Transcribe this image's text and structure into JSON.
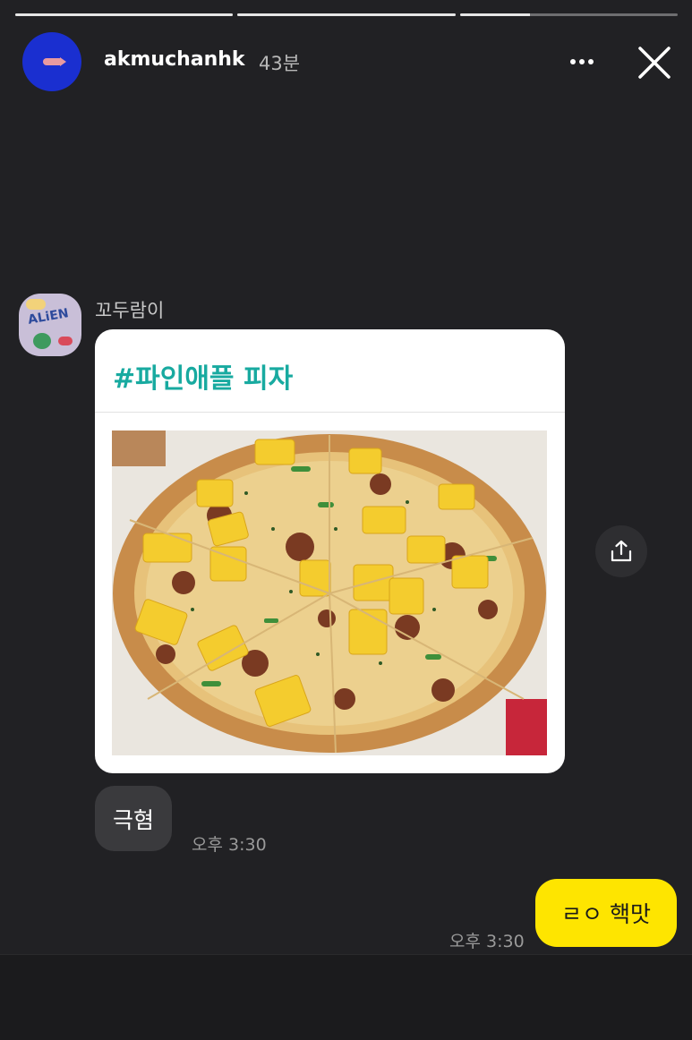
{
  "story": {
    "progress": [
      1.0,
      1.0,
      0.32
    ],
    "username": "akmuchanhk",
    "time": "43분",
    "avatar_color": "#1a2fd0"
  },
  "icons": {
    "more": "more-horizontal-icon",
    "close": "close-icon",
    "share": "share-icon"
  },
  "chat": {
    "sender_name": "꼬두람이",
    "card": {
      "title": "#파인애플 피자",
      "title_color": "#18aaa0"
    },
    "incoming": {
      "text": "극혐",
      "time": "오후 3:30"
    },
    "outgoing": {
      "text": "ㄹㅇ 핵맛",
      "time": "오후 3:30",
      "bubble_color": "#fee500"
    }
  }
}
